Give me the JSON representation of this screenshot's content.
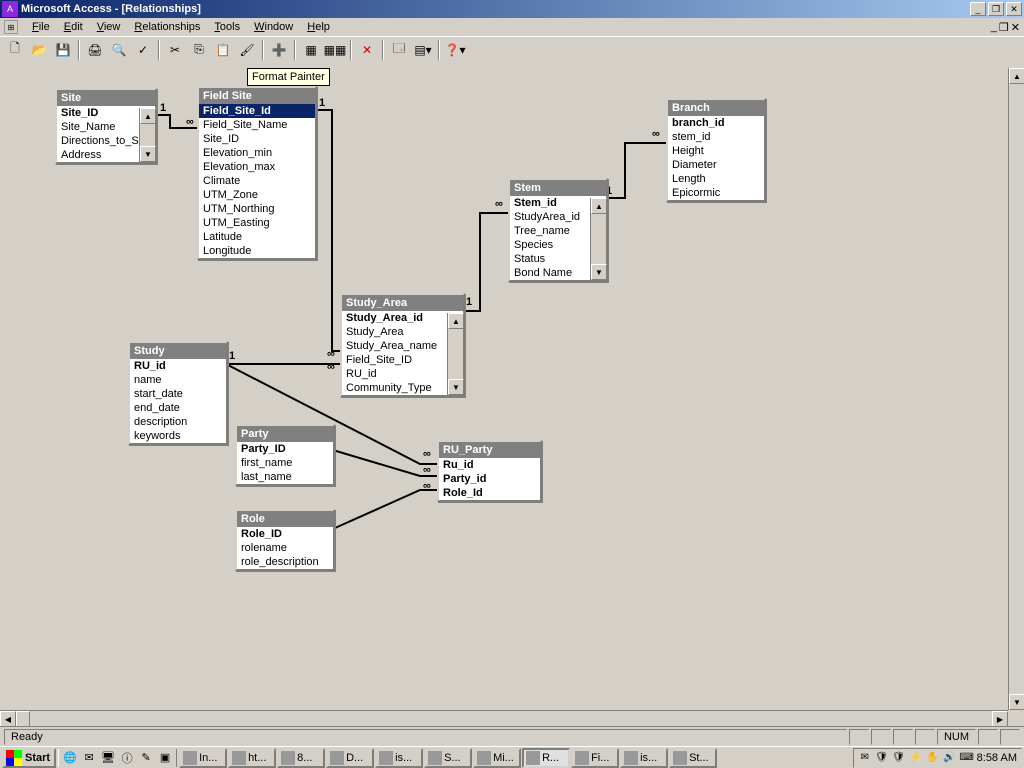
{
  "titlebar": {
    "title": "Microsoft Access - [Relationships]"
  },
  "menubar": {
    "items": [
      "File",
      "Edit",
      "View",
      "Relationships",
      "Tools",
      "Window",
      "Help"
    ]
  },
  "toolbar": {
    "tooltip_text": "Format Painter"
  },
  "tables": {
    "site": {
      "title": "Site",
      "fields": [
        "Site_ID",
        "Site_Name",
        "Directions_to_Si",
        "Address"
      ],
      "bold_fields": [
        "Site_ID"
      ]
    },
    "field_site": {
      "title": "Field Site",
      "fields": [
        "Field_Site_Id",
        "Field_Site_Name",
        "Site_ID",
        "Elevation_min",
        "Elevation_max",
        "Climate",
        "UTM_Zone",
        "UTM_Northing",
        "UTM_Easting",
        "Latitude",
        "Longitude"
      ],
      "bold_fields": [
        "Field_Site_Id"
      ],
      "selected": "Field_Site_Id"
    },
    "branch": {
      "title": "Branch",
      "fields": [
        "branch_id",
        "stem_id",
        "Height",
        "Diameter",
        "Length",
        "Epicormic"
      ],
      "bold_fields": [
        "branch_id"
      ]
    },
    "stem": {
      "title": "Stem",
      "fields": [
        "Stem_id",
        "StudyArea_id",
        "Tree_name",
        "Species",
        "Status",
        "Bond Name"
      ],
      "bold_fields": [
        "Stem_id"
      ]
    },
    "study_area": {
      "title": "Study_Area",
      "fields": [
        "Study_Area_id",
        "Study_Area",
        "Study_Area_name",
        "Field_Site_ID",
        "RU_id",
        "Community_Type"
      ],
      "bold_fields": [
        "Study_Area_id"
      ]
    },
    "study": {
      "title": "Study",
      "fields": [
        "RU_id",
        "name",
        "start_date",
        "end_date",
        "description",
        "keywords"
      ],
      "bold_fields": [
        "RU_id"
      ]
    },
    "party": {
      "title": "Party",
      "fields": [
        "Party_ID",
        "first_name",
        "last_name"
      ],
      "bold_fields": [
        "Party_ID"
      ]
    },
    "role": {
      "title": "Role",
      "fields": [
        "Role_ID",
        "rolename",
        "role_description"
      ],
      "bold_fields": [
        "Role_ID"
      ]
    },
    "ru_party": {
      "title": "RU_Party",
      "fields": [
        "Ru_id",
        "Party_id",
        "Role_Id"
      ],
      "bold_fields": [
        "Ru_id",
        "Party_id",
        "Role_Id"
      ]
    }
  },
  "labels": {
    "one": "1",
    "many": "∞"
  },
  "statusbar": {
    "text": "Ready",
    "num": "NUM"
  },
  "taskbar": {
    "start": "Start",
    "tasks": [
      "In...",
      "ht...",
      "8...",
      "D...",
      "is...",
      "S...",
      "Mi...",
      "R...",
      "Fi...",
      "is...",
      "St..."
    ],
    "active_task_index": 7,
    "clock": "8:58 AM"
  }
}
